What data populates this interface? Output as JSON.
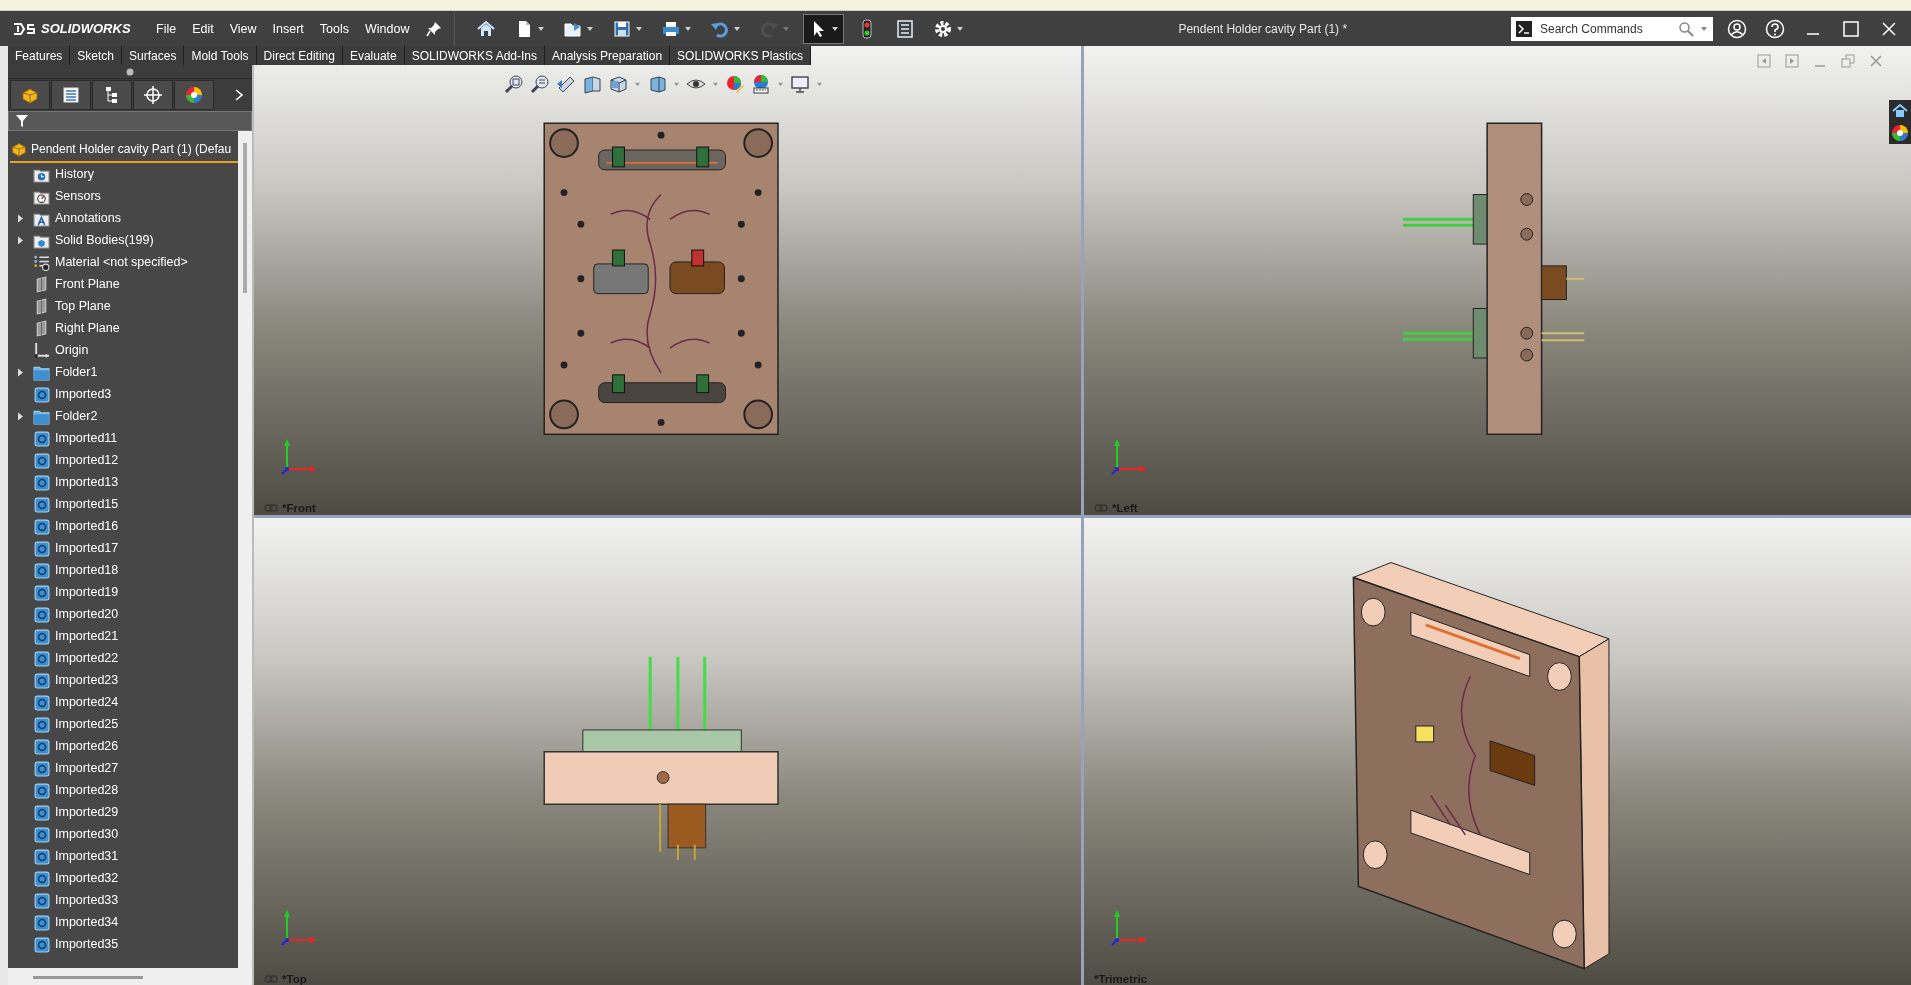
{
  "app": {
    "logo": "SOLIDWORKS"
  },
  "menu": [
    "File",
    "Edit",
    "View",
    "Insert",
    "Tools",
    "Window"
  ],
  "toolbar": [
    {
      "kind": "home",
      "dropdown": false,
      "selected": false,
      "disabled": false
    },
    {
      "kind": "new",
      "dropdown": true,
      "selected": false,
      "disabled": false
    },
    {
      "kind": "open",
      "dropdown": true,
      "selected": false,
      "disabled": false
    },
    {
      "kind": "save",
      "dropdown": true,
      "selected": false,
      "disabled": false
    },
    {
      "kind": "print",
      "dropdown": true,
      "selected": false,
      "disabled": false
    },
    {
      "kind": "undo",
      "dropdown": true,
      "selected": false,
      "disabled": false
    },
    {
      "kind": "redo",
      "dropdown": true,
      "selected": false,
      "disabled": true
    },
    {
      "kind": "select",
      "dropdown": true,
      "selected": true,
      "disabled": false
    },
    {
      "kind": "rebuild",
      "dropdown": false,
      "selected": false,
      "disabled": false
    },
    {
      "kind": "file-properties",
      "dropdown": false,
      "selected": false,
      "disabled": false
    },
    {
      "kind": "options",
      "dropdown": true,
      "selected": false,
      "disabled": false
    }
  ],
  "title": "Pendent Holder cavity Part (1) *",
  "search": {
    "placeholder": "Search Commands"
  },
  "tabs": [
    "Features",
    "Sketch",
    "Surfaces",
    "Mold Tools",
    "Direct Editing",
    "Evaluate",
    "SOLIDWORKS Add-Ins",
    "Analysis Preparation",
    "SOLIDWORKS Plastics"
  ],
  "panel_tabs": [
    {
      "kind": "feature-tree"
    },
    {
      "kind": "property"
    },
    {
      "kind": "configuration"
    },
    {
      "kind": "dimxpert"
    },
    {
      "kind": "display"
    }
  ],
  "tree": {
    "root": "Pendent Holder cavity Part (1) (Defau",
    "items": [
      {
        "label": "History",
        "kind": "history",
        "expandable": false
      },
      {
        "label": "Sensors",
        "kind": "sensors",
        "expandable": false
      },
      {
        "label": "Annotations",
        "kind": "annotations",
        "expandable": true
      },
      {
        "label": "Solid Bodies(199)",
        "kind": "bodies",
        "expandable": true
      },
      {
        "label": "Material <not specified>",
        "kind": "material",
        "expandable": false
      },
      {
        "label": "Front Plane",
        "kind": "plane",
        "expandable": false
      },
      {
        "label": "Top Plane",
        "kind": "plane",
        "expandable": false
      },
      {
        "label": "Right Plane",
        "kind": "plane",
        "expandable": false
      },
      {
        "label": "Origin",
        "kind": "origin",
        "expandable": false
      },
      {
        "label": "Folder1",
        "kind": "folder",
        "expandable": true
      },
      {
        "label": "Imported3",
        "kind": "body",
        "expandable": false
      },
      {
        "label": "Folder2",
        "kind": "folder",
        "expandable": true
      },
      {
        "label": "Imported11",
        "kind": "body",
        "expandable": false
      },
      {
        "label": "Imported12",
        "kind": "body",
        "expandable": false
      },
      {
        "label": "Imported13",
        "kind": "body",
        "expandable": false
      },
      {
        "label": "Imported15",
        "kind": "body",
        "expandable": false
      },
      {
        "label": "Imported16",
        "kind": "body",
        "expandable": false
      },
      {
        "label": "Imported17",
        "kind": "body",
        "expandable": false
      },
      {
        "label": "Imported18",
        "kind": "body",
        "expandable": false
      },
      {
        "label": "Imported19",
        "kind": "body",
        "expandable": false
      },
      {
        "label": "Imported20",
        "kind": "body",
        "expandable": false
      },
      {
        "label": "Imported21",
        "kind": "body",
        "expandable": false
      },
      {
        "label": "Imported22",
        "kind": "body",
        "expandable": false
      },
      {
        "label": "Imported23",
        "kind": "body",
        "expandable": false
      },
      {
        "label": "Imported24",
        "kind": "body",
        "expandable": false
      },
      {
        "label": "Imported25",
        "kind": "body",
        "expandable": false
      },
      {
        "label": "Imported26",
        "kind": "body",
        "expandable": false
      },
      {
        "label": "Imported27",
        "kind": "body",
        "expandable": false
      },
      {
        "label": "Imported28",
        "kind": "body",
        "expandable": false
      },
      {
        "label": "Imported29",
        "kind": "body",
        "expandable": false
      },
      {
        "label": "Imported30",
        "kind": "body",
        "expandable": false
      },
      {
        "label": "Imported31",
        "kind": "body",
        "expandable": false
      },
      {
        "label": "Imported32",
        "kind": "body",
        "expandable": false
      },
      {
        "label": "Imported33",
        "kind": "body",
        "expandable": false
      },
      {
        "label": "Imported34",
        "kind": "body",
        "expandable": false
      },
      {
        "label": "Imported35",
        "kind": "body",
        "expandable": false
      }
    ]
  },
  "view_toolbar": [
    {
      "kind": "zoom-fit",
      "dropdown": false
    },
    {
      "kind": "zoom-area",
      "dropdown": false
    },
    {
      "kind": "previous-view",
      "dropdown": false
    },
    {
      "kind": "section-view",
      "dropdown": false
    },
    {
      "kind": "view-orientation",
      "dropdown": true
    },
    {
      "kind": "display-style",
      "dropdown": true
    },
    {
      "kind": "hide-show",
      "dropdown": true
    },
    {
      "kind": "appearance",
      "dropdown": false
    },
    {
      "kind": "scene",
      "dropdown": true
    },
    {
      "kind": "display-settings",
      "dropdown": true
    }
  ],
  "viewports": [
    {
      "label": "*Front",
      "kind": "front",
      "linked": true
    },
    {
      "label": "*Left",
      "kind": "left",
      "linked": true
    },
    {
      "label": "*Top",
      "kind": "top",
      "linked": true
    },
    {
      "label": "*Trimetric",
      "kind": "trimetric",
      "linked": false
    }
  ]
}
